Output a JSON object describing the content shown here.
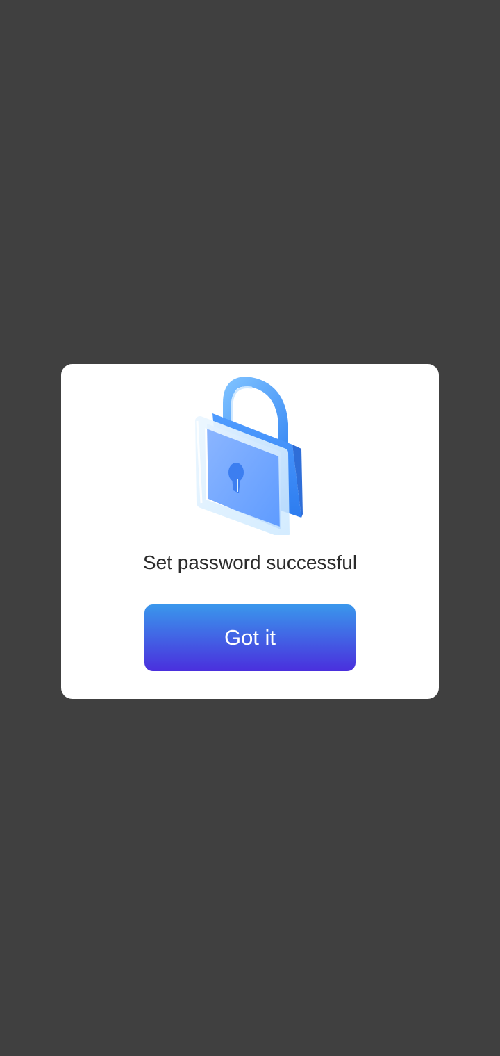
{
  "dialog": {
    "icon": "padlock-icon",
    "message": "Set password successful",
    "confirm_label": "Got it"
  },
  "colors": {
    "overlay": "#404040",
    "dialog_bg": "#ffffff",
    "button_gradient_top": "#3a97ec",
    "button_gradient_bottom": "#4a2fdd",
    "text": "#2b2b2b"
  }
}
